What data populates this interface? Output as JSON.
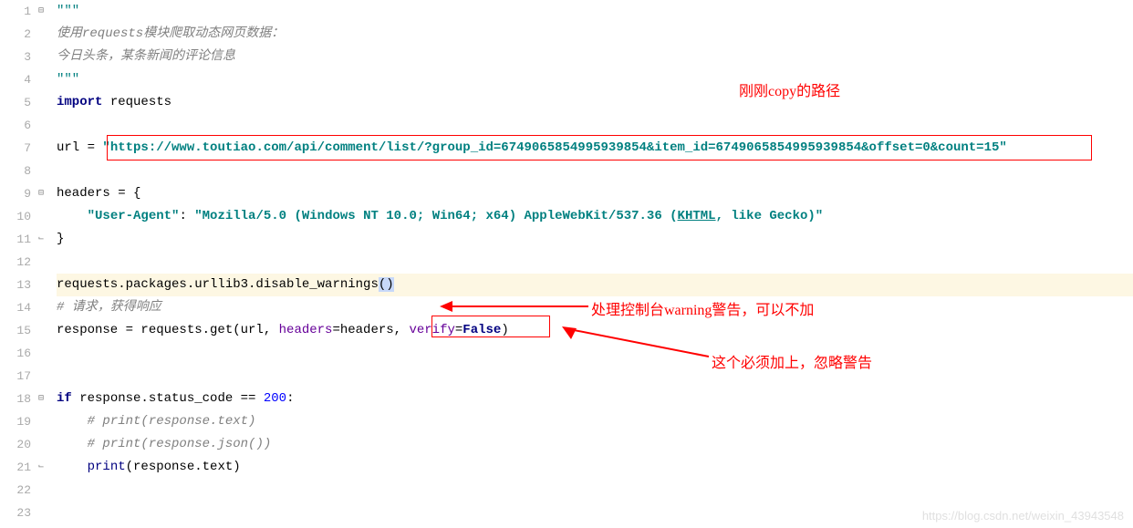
{
  "gutter": [
    "1",
    "2",
    "3",
    "4",
    "5",
    "6",
    "7",
    "8",
    "9",
    "10",
    "11",
    "12",
    "13",
    "14",
    "15",
    "16",
    "17",
    "18",
    "19",
    "20",
    "21",
    "22",
    "23"
  ],
  "code": {
    "l1": "\"\"\"",
    "l2": "使用requests模块爬取动态网页数据：",
    "l3": "今日头条，某条新闻的评论信息",
    "l4": "\"\"\"",
    "l5_kw": "import",
    "l5_mod": " requests",
    "l7_a": "url = ",
    "l7_url": "\"https://www.toutiao.com/api/comment/list/?group_id=6749065854995939854&item_id=6749065854995939854&offset=0&count=15\"",
    "l9": "headers = {",
    "l10_key": "\"User-Agent\"",
    "l10_colon": ": ",
    "l10_val_a": "\"Mozilla/5.0 (Windows NT 10.0; Win64; x64) AppleWebKit/537.36 (",
    "l10_val_u": "KHTML",
    "l10_val_b": ", like Gecko)\"",
    "l11": "}",
    "l13_a": "requests.packages.urllib3.disable_warnings",
    "l13_b": "()",
    "l14": "# 请求，获得响应",
    "l15_a": "response = requests.get(url, ",
    "l15_p1": "headers",
    "l15_b": "=headers, ",
    "l15_p2": "verify",
    "l15_c": "=",
    "l15_false": "False",
    "l15_d": ")",
    "l18_kw": "if",
    "l18_a": " response.status_code == ",
    "l18_num": "200",
    "l18_b": ":",
    "l19": "# print(response.text)",
    "l20": "# print(response.json())",
    "l21_a": "print",
    "l21_b": "(response.text)"
  },
  "annotations": {
    "a1": "刚刚copy的路径",
    "a2": "处理控制台warning警告，可以不加",
    "a3": "这个必须加上，忽略警告"
  },
  "watermark": "https://blog.csdn.net/weixin_43943548"
}
